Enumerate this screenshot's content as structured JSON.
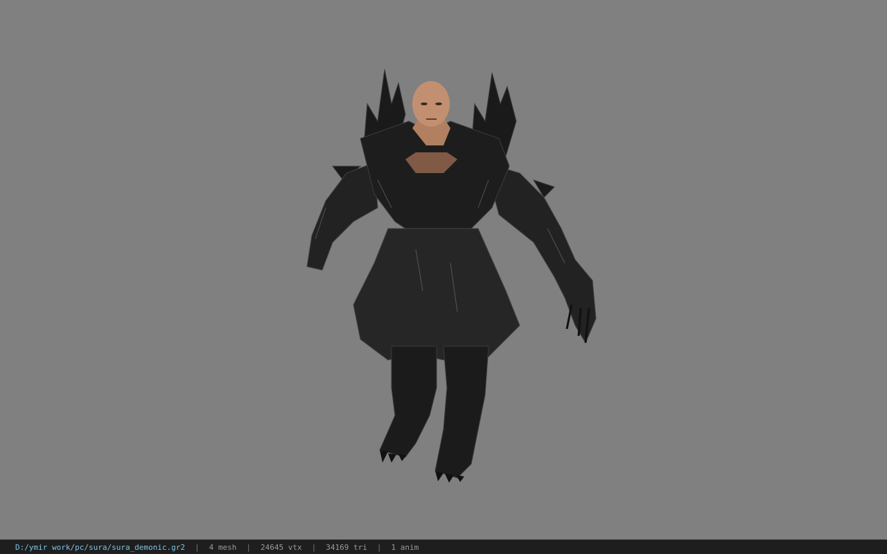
{
  "viewer": {
    "background_color": "#808080",
    "model_description_icon": "armored-demon-character-icon"
  },
  "status_bar": {
    "file_path": "D:/ymir work/pc/sura/sura_demonic.gr2",
    "separator": "|",
    "mesh_count": "4 mesh",
    "vertex_count": "24645 vtx",
    "triangle_count": "34169 tri",
    "animation_count": "1 anim",
    "path_color": "#7ec3e6"
  }
}
